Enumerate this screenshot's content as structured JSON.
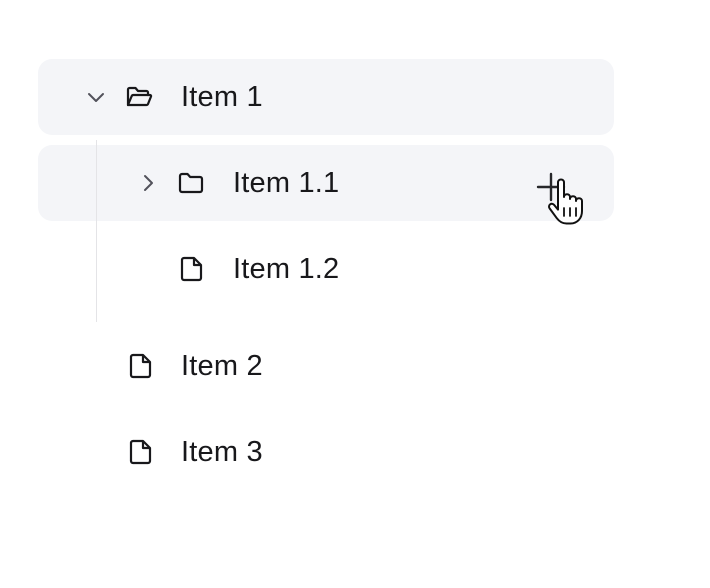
{
  "tree": {
    "items": [
      {
        "label": "Item 1",
        "icon": "folder-open-icon",
        "expanded": true,
        "highlighted": true
      },
      {
        "label": "Item 1.1",
        "icon": "folder-icon",
        "expanded": false,
        "highlighted": true,
        "action_icon": "plus-icon"
      },
      {
        "label": "Item 1.2",
        "icon": "file-icon",
        "highlighted": false
      },
      {
        "label": "Item 2",
        "icon": "file-icon",
        "highlighted": false
      },
      {
        "label": "Item 3",
        "icon": "file-icon",
        "highlighted": false
      }
    ]
  },
  "colors": {
    "row_highlight": "#f4f5f8",
    "guide_line": "#e4e4e7",
    "text": "#18181b",
    "chevron": "#52525b"
  }
}
